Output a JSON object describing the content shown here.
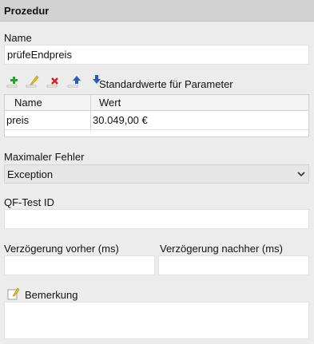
{
  "panel": {
    "title": "Prozedur"
  },
  "name": {
    "label": "Name",
    "value": "prüfeEndpreis"
  },
  "params": {
    "toolbar": {
      "add_icon": "plus-icon",
      "edit_icon": "pencil-icon",
      "delete_icon": "delete-x-icon",
      "up_icon": "arrow-up-icon",
      "down_icon": "arrow-down-icon"
    },
    "label": "Standardwerte für Parameter",
    "columns": [
      "Name",
      "Wert"
    ],
    "rows": [
      {
        "name": "preis",
        "wert": "30.049,00 €"
      }
    ]
  },
  "max_error": {
    "label": "Maximaler Fehler",
    "selected": "Exception"
  },
  "qftest_id": {
    "label": "QF-Test ID",
    "value": ""
  },
  "delay_before": {
    "label": "Verzögerung vorher (ms)",
    "value": ""
  },
  "delay_after": {
    "label": "Verzögerung nachher (ms)",
    "value": ""
  },
  "comment": {
    "label": "Bemerkung",
    "icon": "pencil-note-icon",
    "value": ""
  },
  "colors": {
    "add": "#2e9e2e",
    "delete": "#d42020",
    "arrow": "#2a5bb8",
    "pencil": "#e8c21c"
  }
}
